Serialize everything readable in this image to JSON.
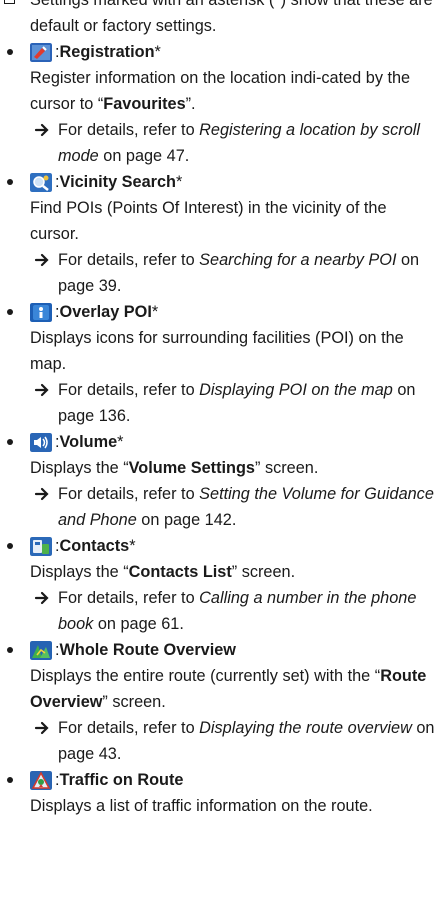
{
  "note": "Settings marked with an asterisk (*) show that these are default or factory settings.",
  "items": [
    {
      "icon": "registration-icon",
      "title": "Registration",
      "asterisk": "*",
      "desc_parts": [
        "Register information on the location indi-cated by the cursor to “",
        "Favourites",
        "”."
      ],
      "ref_prefix": "For details, refer to ",
      "ref_link": "Registering a location by scroll mode",
      "ref_suffix": " on page 47."
    },
    {
      "icon": "vicinity-search-icon",
      "title": "Vicinity Search",
      "asterisk": "*",
      "desc": "Find POIs (Points Of Interest) in the vicinity of the cursor.",
      "ref_prefix": "For details, refer to ",
      "ref_link": "Searching for a nearby POI",
      "ref_suffix": " on page 39."
    },
    {
      "icon": "overlay-poi-icon",
      "title": "Overlay POI",
      "asterisk": "*",
      "desc": "Displays icons for surrounding facilities (POI) on the map.",
      "ref_prefix": "For details, refer to ",
      "ref_link": "Displaying POI on the map",
      "ref_suffix": " on page 136."
    },
    {
      "icon": "volume-icon",
      "title": "Volume",
      "asterisk": "*",
      "desc_parts": [
        "Displays the “",
        "Volume Settings",
        "” screen."
      ],
      "ref_prefix": "For details, refer to ",
      "ref_link": "Setting the Volume for Guidance and Phone",
      "ref_suffix": " on page 142."
    },
    {
      "icon": "contacts-icon",
      "title": "Contacts",
      "asterisk": "*",
      "desc_parts": [
        "Displays the “",
        "Contacts List",
        "” screen."
      ],
      "ref_prefix": "For details, refer to ",
      "ref_link": "Calling a number in the phone book",
      "ref_suffix": " on page 61."
    },
    {
      "icon": "whole-route-overview-icon",
      "title": "Whole Route Overview",
      "asterisk": "",
      "desc_parts": [
        "Displays the entire route (currently set) with the “",
        "Route Overview",
        "” screen."
      ],
      "ref_prefix": "For details, refer to ",
      "ref_link": "Displaying the route overview",
      "ref_suffix": " on page 43."
    },
    {
      "icon": "traffic-on-route-icon",
      "title": "Traffic on Route",
      "asterisk": "",
      "desc": "Displays a list of traffic information on the route."
    }
  ]
}
